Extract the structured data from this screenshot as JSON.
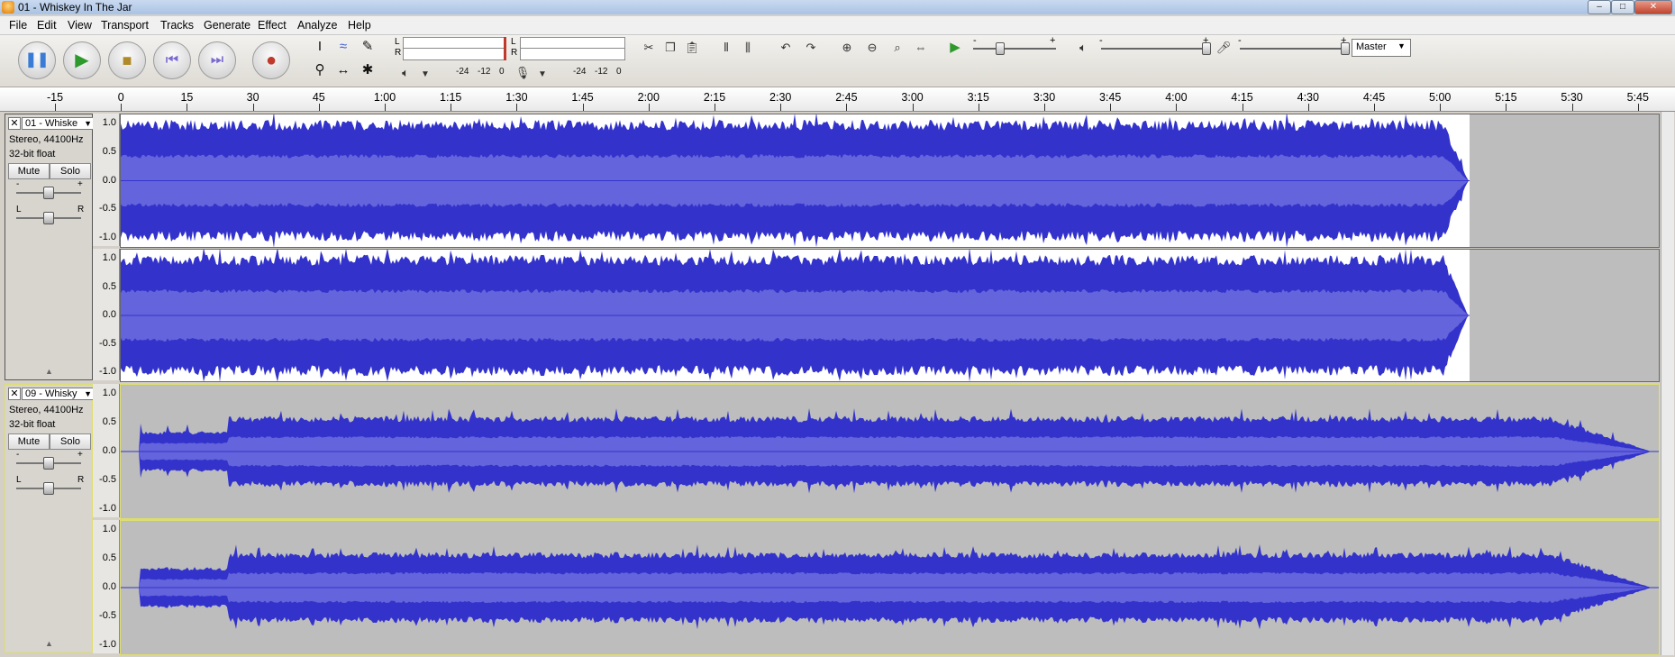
{
  "window": {
    "title": "01 - Whiskey In The Jar",
    "minimize_label": "–",
    "maximize_label": "□",
    "close_label": "✕"
  },
  "menu": [
    "File",
    "Edit",
    "View",
    "Transport",
    "Tracks",
    "Generate",
    "Effect",
    "Analyze",
    "Help"
  ],
  "transport": {
    "pause": "pause-icon",
    "play": "play-icon",
    "stop": "stop-icon",
    "skip_start": "skip-to-start-icon",
    "skip_end": "skip-to-end-icon",
    "record": "record-icon"
  },
  "meters": {
    "left_channel": "L",
    "right_channel": "R",
    "playback_scale": [
      "-24",
      "-12",
      "0"
    ],
    "record_scale": [
      "-24",
      "-12",
      "0"
    ],
    "playback_meter_L": "L",
    "playback_meter_R": "R"
  },
  "mixer": {
    "minus": "-",
    "plus": "+",
    "source": "Master"
  },
  "ruler": {
    "labels": [
      "-15",
      "0",
      "15",
      "30",
      "45",
      "1:00",
      "1:15",
      "1:30",
      "1:45",
      "2:00",
      "2:15",
      "2:30",
      "2:45",
      "3:00",
      "3:15",
      "3:30",
      "3:45",
      "4:00",
      "4:15",
      "4:30",
      "4:45",
      "5:00",
      "5:15",
      "5:30",
      "5:45"
    ]
  },
  "tracks": [
    {
      "name": "01 - Whiske",
      "format": "Stereo, 44100Hz",
      "bits": "32-bit float",
      "mute": "Mute",
      "solo": "Solo",
      "gain_minus": "-",
      "gain_plus": "+",
      "pan_left": "L",
      "pan_right": "R",
      "axis": [
        "1.0",
        "0.5",
        "0.0",
        "-0.5",
        "-1.0"
      ],
      "end_time": "5:02"
    },
    {
      "name": "09 - Whisky",
      "format": "Stereo, 44100Hz",
      "bits": "32-bit float",
      "mute": "Mute",
      "solo": "Solo",
      "gain_minus": "-",
      "gain_plus": "+",
      "pan_left": "L",
      "pan_right": "R",
      "axis": [
        "1.0",
        "0.5",
        "0.0",
        "-0.5",
        "-1.0"
      ],
      "end_time": "5:48"
    }
  ],
  "colors": {
    "wave_fill": "#3333cc",
    "wave_rms": "#6464dc",
    "track_bg": "#bdbdbd",
    "selected_border": "#dede6e"
  }
}
